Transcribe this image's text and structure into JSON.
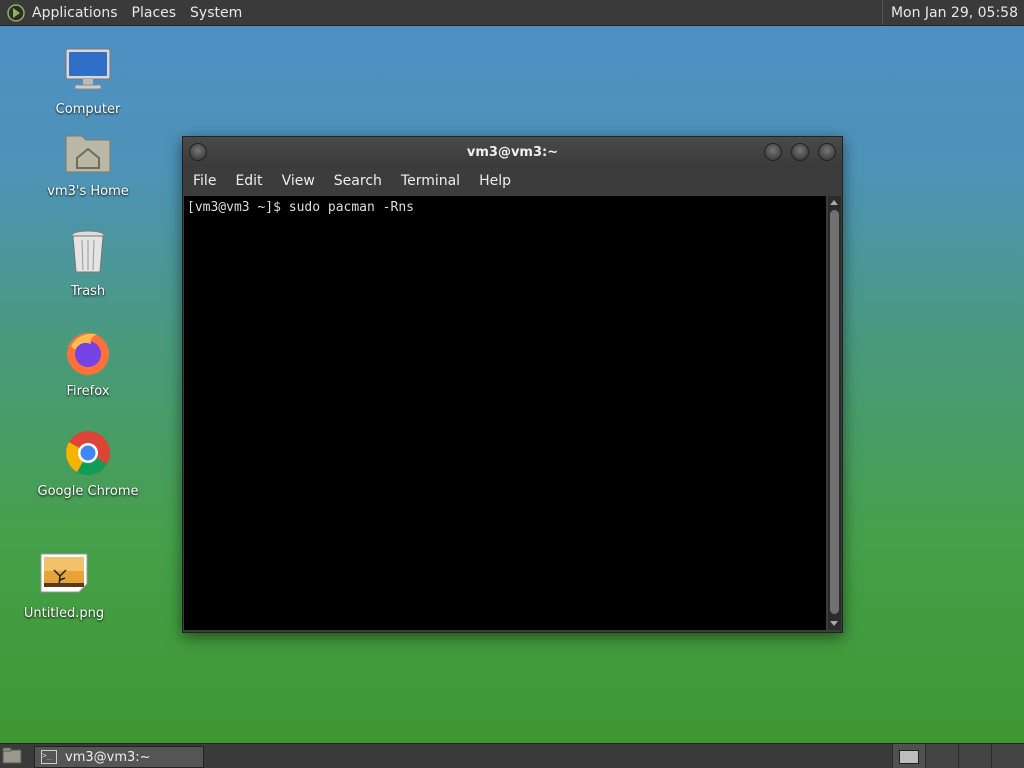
{
  "top_panel": {
    "menus": [
      "Applications",
      "Places",
      "System"
    ],
    "clock": "Mon Jan 29, 05:58"
  },
  "desktop_icons": [
    {
      "label": "Computer",
      "icon": "computer-icon"
    },
    {
      "label": "vm3's Home",
      "icon": "home-folder-icon"
    },
    {
      "label": "Trash",
      "icon": "trash-icon"
    },
    {
      "label": "Firefox",
      "icon": "firefox-icon"
    },
    {
      "label": "Google Chrome",
      "icon": "chrome-icon"
    },
    {
      "label": "Untitled.png",
      "icon": "image-file-icon"
    }
  ],
  "terminal": {
    "title": "vm3@vm3:~",
    "menu": [
      "File",
      "Edit",
      "View",
      "Search",
      "Terminal",
      "Help"
    ],
    "prompt_line": "[vm3@vm3 ~]$ sudo pacman -Rns"
  },
  "taskbar": {
    "task_label": "vm3@vm3:~"
  },
  "colors": {
    "panel": "#3a3a3a",
    "terminal_bg": "#000000"
  }
}
